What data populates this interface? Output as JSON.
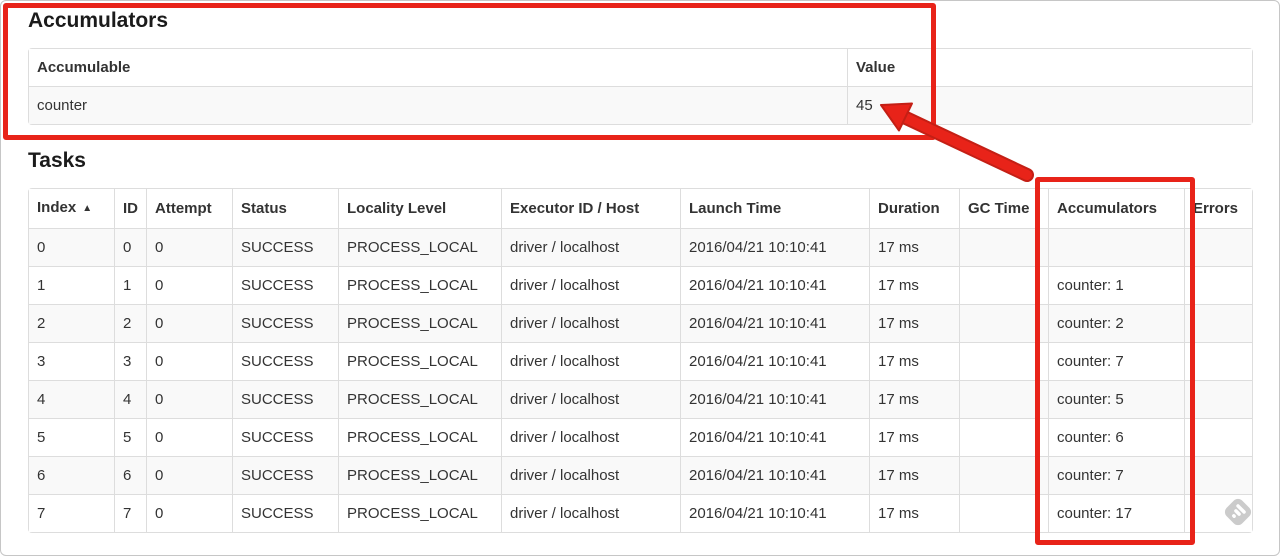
{
  "annotation": {
    "color": "#e82319",
    "boxes": [
      "accumulators-summary",
      "accumulators-column"
    ],
    "arrow_points_to": "45"
  },
  "accumulators_section": {
    "heading": "Accumulators",
    "table": {
      "headers": [
        "Accumulable",
        "Value"
      ],
      "rows": [
        [
          "counter",
          "45"
        ]
      ]
    }
  },
  "tasks_section": {
    "heading": "Tasks",
    "table": {
      "sort_icon": "▲",
      "headers": [
        "Index",
        "ID",
        "Attempt",
        "Status",
        "Locality Level",
        "Executor ID / Host",
        "Launch Time",
        "Duration",
        "GC Time",
        "Accumulators",
        "Errors"
      ],
      "rows": [
        [
          "0",
          "0",
          "0",
          "SUCCESS",
          "PROCESS_LOCAL",
          "driver / localhost",
          "2016/04/21 10:10:41",
          "17 ms",
          "",
          "",
          ""
        ],
        [
          "1",
          "1",
          "0",
          "SUCCESS",
          "PROCESS_LOCAL",
          "driver / localhost",
          "2016/04/21 10:10:41",
          "17 ms",
          "",
          "counter: 1",
          ""
        ],
        [
          "2",
          "2",
          "0",
          "SUCCESS",
          "PROCESS_LOCAL",
          "driver / localhost",
          "2016/04/21 10:10:41",
          "17 ms",
          "",
          "counter: 2",
          ""
        ],
        [
          "3",
          "3",
          "0",
          "SUCCESS",
          "PROCESS_LOCAL",
          "driver / localhost",
          "2016/04/21 10:10:41",
          "17 ms",
          "",
          "counter: 7",
          ""
        ],
        [
          "4",
          "4",
          "0",
          "SUCCESS",
          "PROCESS_LOCAL",
          "driver / localhost",
          "2016/04/21 10:10:41",
          "17 ms",
          "",
          "counter: 5",
          ""
        ],
        [
          "5",
          "5",
          "0",
          "SUCCESS",
          "PROCESS_LOCAL",
          "driver / localhost",
          "2016/04/21 10:10:41",
          "17 ms",
          "",
          "counter: 6",
          ""
        ],
        [
          "6",
          "6",
          "0",
          "SUCCESS",
          "PROCESS_LOCAL",
          "driver / localhost",
          "2016/04/21 10:10:41",
          "17 ms",
          "",
          "counter: 7",
          ""
        ],
        [
          "7",
          "7",
          "0",
          "SUCCESS",
          "PROCESS_LOCAL",
          "driver / localhost",
          "2016/04/21 10:10:41",
          "17 ms",
          "",
          "counter: 17",
          ""
        ]
      ]
    }
  }
}
